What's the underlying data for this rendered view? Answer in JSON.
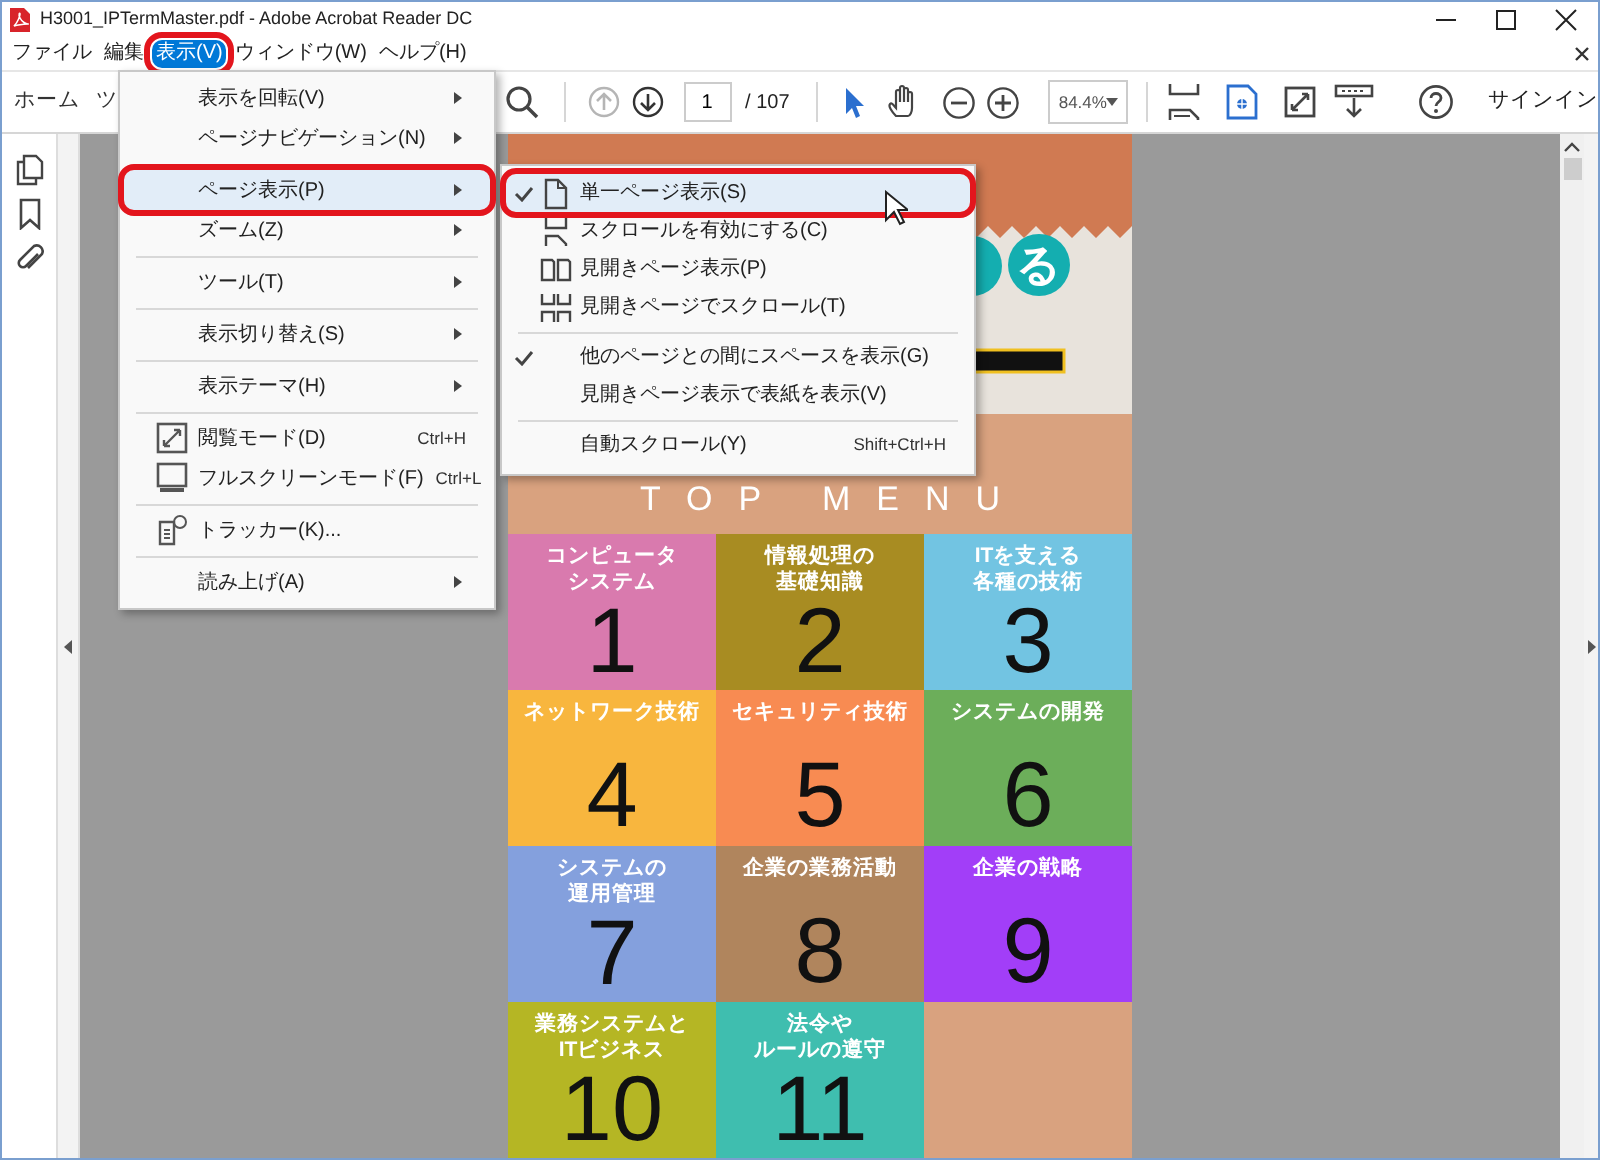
{
  "window": {
    "title": "H3001_IPTermMaster.pdf - Adobe Acrobat Reader DC"
  },
  "menu_bar": [
    {
      "label": "ファイル",
      "selected": false,
      "highlighted": false
    },
    {
      "label": "編集",
      "selected": false,
      "highlighted": false
    },
    {
      "label": "表示(V)",
      "selected": true,
      "highlighted": true
    },
    {
      "label": "ウィンドウ(W)",
      "selected": false,
      "highlighted": false
    },
    {
      "label": "ヘルプ(H)",
      "selected": false,
      "highlighted": false
    }
  ],
  "toolbar": {
    "tabs": [
      {
        "label": "ホーム"
      },
      {
        "label": "ツ"
      }
    ],
    "previous_page": {
      "disabled": true
    },
    "next_page": {
      "disabled": false
    },
    "page_number": "1",
    "page_total": "/ 107",
    "zoom": "84.4%",
    "sign_in": "サインイン"
  },
  "view_menu": [
    {
      "kind": "item",
      "label": "表示を回転(V)",
      "submenu": true,
      "selected": false,
      "highlighted": false
    },
    {
      "kind": "item",
      "label": "ページナビゲーション(N)",
      "submenu": true,
      "selected": false,
      "highlighted": false
    },
    {
      "kind": "separator"
    },
    {
      "kind": "item",
      "label": "ページ表示(P)",
      "submenu": true,
      "selected": true,
      "highlighted": true
    },
    {
      "kind": "item",
      "label": "ズーム(Z)",
      "submenu": true,
      "selected": false,
      "highlighted": false
    },
    {
      "kind": "separator"
    },
    {
      "kind": "item",
      "label": "ツール(T)",
      "submenu": true,
      "selected": false,
      "highlighted": false
    },
    {
      "kind": "separator"
    },
    {
      "kind": "item",
      "label": "表示切り替え(S)",
      "submenu": true,
      "selected": false,
      "highlighted": false
    },
    {
      "kind": "separator"
    },
    {
      "kind": "item",
      "label": "表示テーマ(H)",
      "submenu": true,
      "selected": false,
      "highlighted": false
    },
    {
      "kind": "separator"
    },
    {
      "kind": "item",
      "label": "閲覧モード(D)",
      "shortcut": "Ctrl+H",
      "submenu": false,
      "selected": false,
      "highlighted": false
    },
    {
      "kind": "item",
      "label": "フルスクリーンモード(F)",
      "shortcut": "Ctrl+L",
      "submenu": false,
      "selected": false,
      "highlighted": false
    },
    {
      "kind": "separator"
    },
    {
      "kind": "item",
      "label": "トラッカー(K)...",
      "submenu": false,
      "selected": false,
      "highlighted": false
    },
    {
      "kind": "separator"
    },
    {
      "kind": "item",
      "label": "読み上げ(A)",
      "submenu": true,
      "selected": false,
      "highlighted": false
    }
  ],
  "page_display_submenu": [
    {
      "kind": "item",
      "label": "単一ページ表示(S)",
      "checked": true,
      "selected": true,
      "highlighted": true
    },
    {
      "kind": "item",
      "label": "スクロールを有効にする(C)",
      "checked": false,
      "selected": false,
      "highlighted": false
    },
    {
      "kind": "item",
      "label": "見開きページ表示(P)",
      "checked": false,
      "selected": false,
      "highlighted": false
    },
    {
      "kind": "item",
      "label": "見開きページでスクロール(T)",
      "checked": false,
      "selected": false,
      "highlighted": false
    },
    {
      "kind": "separator"
    },
    {
      "kind": "item",
      "label": "他のページとの間にスペースを表示(G)",
      "checked": true,
      "selected": false,
      "highlighted": false
    },
    {
      "kind": "item",
      "label": "見開きページ表示で表紙を表示(V)",
      "checked": false,
      "selected": false,
      "highlighted": false
    },
    {
      "kind": "separator"
    },
    {
      "kind": "item",
      "label": "自動スクロール(Y)",
      "shortcut": "Shift+Ctrl+H",
      "checked": false,
      "selected": false,
      "highlighted": false
    }
  ],
  "document": {
    "badge": "る",
    "heading": "TOP MENU",
    "tiles": [
      {
        "label_lines": [
          "コンピュータ",
          "システム"
        ],
        "number": "1",
        "color": "#d97aae"
      },
      {
        "label_lines": [
          "情報処理の",
          "基礎知識"
        ],
        "number": "2",
        "color": "#a88c22"
      },
      {
        "label_lines": [
          "ITを支える",
          "各種の技術"
        ],
        "number": "3",
        "color": "#72c4e2"
      },
      {
        "label_lines": [
          "ネットワーク技術"
        ],
        "number": "4",
        "color": "#f8b63e"
      },
      {
        "label_lines": [
          "セキュリティ技術"
        ],
        "number": "5",
        "color": "#f88b52"
      },
      {
        "label_lines": [
          "システムの開発"
        ],
        "number": "6",
        "color": "#6cae5a"
      },
      {
        "label_lines": [
          "システムの",
          "運用管理"
        ],
        "number": "7",
        "color": "#84a0dd"
      },
      {
        "label_lines": [
          "企業の業務活動"
        ],
        "number": "8",
        "color": "#b0855d"
      },
      {
        "label_lines": [
          "企業の戦略"
        ],
        "number": "9",
        "color": "#a23ef8"
      },
      {
        "label_lines": [
          "業務システムと",
          "ITビジネス"
        ],
        "number": "10",
        "color": "#b5b624"
      },
      {
        "label_lines": [
          "法令や",
          "ルールの遵守"
        ],
        "number": "11",
        "color": "#3fbeaf"
      }
    ]
  }
}
